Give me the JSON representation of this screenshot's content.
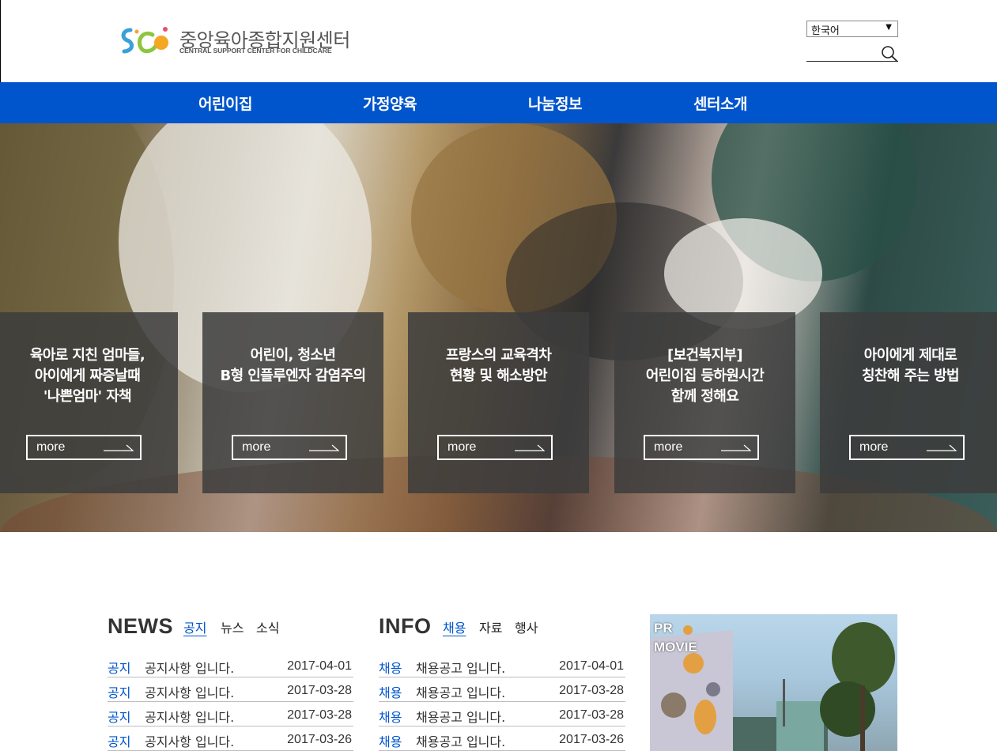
{
  "header": {
    "logo_title": "중앙육아종합지원센터",
    "logo_subtitle": "CENTRAL SUPPORT CENTER FOR CHILDCARE",
    "language": "한국어"
  },
  "nav": {
    "items": [
      {
        "label": "어린이집"
      },
      {
        "label": "가정양육"
      },
      {
        "label": "나눔정보"
      },
      {
        "label": "센터소개"
      }
    ]
  },
  "hero": {
    "cards": [
      {
        "title": "육아로 지친 엄마들,\n아이에게 짜증날때\n'나쁜엄마' 자책",
        "more": "more"
      },
      {
        "title": "어린이, 청소년\nB형 인플루엔자 감염주의",
        "more": "more"
      },
      {
        "title": "프랑스의 교육격차\n현황 및 해소방안",
        "more": "more"
      },
      {
        "title": "[보건복지부]\n어린이집 등하원시간\n함께 정해요",
        "more": "more"
      },
      {
        "title": "아이에게 제대로\n칭찬해 주는 방법",
        "more": "more"
      }
    ]
  },
  "news": {
    "title": "NEWS",
    "tabs": [
      "공지",
      "뉴스",
      "소식"
    ],
    "rows": [
      {
        "category": "공지",
        "title": "공지사항 입니다.",
        "date": "2017-04-01"
      },
      {
        "category": "공지",
        "title": "공지사항 입니다.",
        "date": "2017-03-28"
      },
      {
        "category": "공지",
        "title": "공지사항 입니다.",
        "date": "2017-03-28"
      },
      {
        "category": "공지",
        "title": "공지사항 입니다.",
        "date": "2017-03-26"
      }
    ]
  },
  "info": {
    "title": "INFO",
    "tabs": [
      "채용",
      "자료",
      "행사"
    ],
    "rows": [
      {
        "category": "채용",
        "title": "채용공고 입니다.",
        "date": "2017-04-01"
      },
      {
        "category": "채용",
        "title": "채용공고 입니다.",
        "date": "2017-03-28"
      },
      {
        "category": "채용",
        "title": "채용공고 입니다.",
        "date": "2017-03-28"
      },
      {
        "category": "채용",
        "title": "채용공고 입니다.",
        "date": "2017-03-26"
      }
    ]
  },
  "pr": {
    "line1": "PR",
    "line2": "MOVIE"
  },
  "colors": {
    "brand_blue": "#0055cc",
    "card_overlay": "#3c3c3c"
  }
}
